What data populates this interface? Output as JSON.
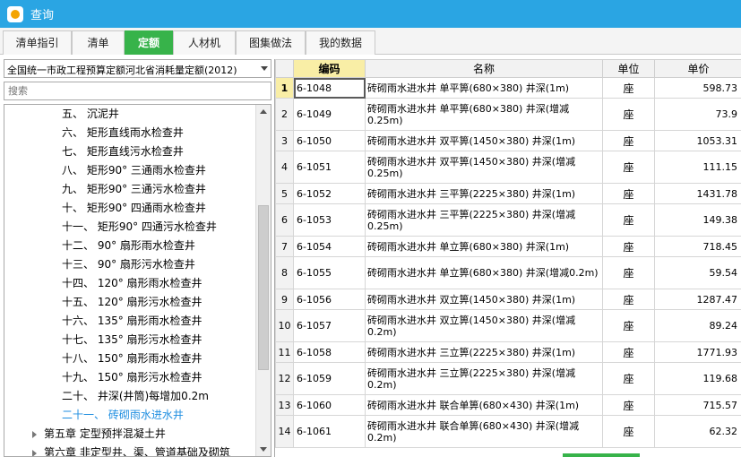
{
  "window": {
    "title": "查询"
  },
  "tabs": [
    {
      "label": "清单指引",
      "active": false
    },
    {
      "label": "清单",
      "active": false
    },
    {
      "label": "定额",
      "active": true
    },
    {
      "label": "人材机",
      "active": false
    },
    {
      "label": "图集做法",
      "active": false
    },
    {
      "label": "我的数据",
      "active": false
    }
  ],
  "left_panel": {
    "library_selected": "全国统一市政工程预算定额河北省消耗量定额(2012)",
    "search_placeholder": "搜索",
    "tree_items": [
      {
        "label": "五、 沉泥井",
        "level": 2
      },
      {
        "label": "六、 矩形直线雨水检查井",
        "level": 2
      },
      {
        "label": "七、 矩形直线污水检查井",
        "level": 2
      },
      {
        "label": "八、 矩形90° 三通雨水检查井",
        "level": 2
      },
      {
        "label": "九、 矩形90° 三通污水检查井",
        "level": 2
      },
      {
        "label": "十、 矩形90° 四通雨水检查井",
        "level": 2
      },
      {
        "label": "十一、 矩形90° 四通污水检查井",
        "level": 2
      },
      {
        "label": "十二、 90° 扇形雨水检查井",
        "level": 2
      },
      {
        "label": "十三、 90° 扇形污水检查井",
        "level": 2
      },
      {
        "label": "十四、 120° 扇形雨水检查井",
        "level": 2
      },
      {
        "label": "十五、 120° 扇形污水检查井",
        "level": 2
      },
      {
        "label": "十六、 135° 扇形雨水检查井",
        "level": 2
      },
      {
        "label": "十七、 135° 扇形污水检查井",
        "level": 2
      },
      {
        "label": "十八、 150° 扇形雨水检查井",
        "level": 2
      },
      {
        "label": "十九、 150° 扇形污水检查井",
        "level": 2
      },
      {
        "label": "二十、 井深(井筒)每增加0.2m",
        "level": 2
      },
      {
        "label": "二十一、 砖砌雨水进水井",
        "level": 2,
        "selected": true
      },
      {
        "label": "第五章 定型预拌混凝土井",
        "level": 1
      },
      {
        "label": "第六章 非定型井、渠、管道基础及砌筑",
        "level": 1
      }
    ]
  },
  "grid": {
    "headers": {
      "row_no": "",
      "code": "编码",
      "name": "名称",
      "unit": "单位",
      "price": "单价"
    },
    "rows": [
      {
        "no": "1",
        "code": "6-1048",
        "name": "砖砌雨水进水井 单平箅(680×380) 井深(1m)",
        "unit": "座",
        "price": "598.73"
      },
      {
        "no": "2",
        "code": "6-1049",
        "name": "砖砌雨水进水井 单平箅(680×380) 井深(增减0.25m)",
        "unit": "座",
        "price": "73.9"
      },
      {
        "no": "3",
        "code": "6-1050",
        "name": "砖砌雨水进水井 双平箅(1450×380) 井深(1m)",
        "unit": "座",
        "price": "1053.31"
      },
      {
        "no": "4",
        "code": "6-1051",
        "name": "砖砌雨水进水井 双平箅(1450×380) 井深(增减0.25m)",
        "unit": "座",
        "price": "111.15"
      },
      {
        "no": "5",
        "code": "6-1052",
        "name": "砖砌雨水进水井 三平箅(2225×380) 井深(1m)",
        "unit": "座",
        "price": "1431.78"
      },
      {
        "no": "6",
        "code": "6-1053",
        "name": "砖砌雨水进水井 三平箅(2225×380) 井深(增减0.25m)",
        "unit": "座",
        "price": "149.38"
      },
      {
        "no": "7",
        "code": "6-1054",
        "name": "砖砌雨水进水井 单立箅(680×380) 井深(1m)",
        "unit": "座",
        "price": "718.45"
      },
      {
        "no": "8",
        "code": "6-1055",
        "name": "砖砌雨水进水井 单立箅(680×380) 井深(增减0.2m)",
        "unit": "座",
        "price": "59.54"
      },
      {
        "no": "9",
        "code": "6-1056",
        "name": "砖砌雨水进水井 双立箅(1450×380) 井深(1m)",
        "unit": "座",
        "price": "1287.47"
      },
      {
        "no": "10",
        "code": "6-1057",
        "name": "砖砌雨水进水井 双立箅(1450×380) 井深(增减0.2m)",
        "unit": "座",
        "price": "89.24"
      },
      {
        "no": "11",
        "code": "6-1058",
        "name": "砖砌雨水进水井 三立箅(2225×380) 井深(1m)",
        "unit": "座",
        "price": "1771.93"
      },
      {
        "no": "12",
        "code": "6-1059",
        "name": "砖砌雨水进水井 三立箅(2225×380) 井深(增减0.2m)",
        "unit": "座",
        "price": "119.68"
      },
      {
        "no": "13",
        "code": "6-1060",
        "name": "砖砌雨水进水井 联合单箅(680×430) 井深(1m)",
        "unit": "座",
        "price": "715.57"
      },
      {
        "no": "14",
        "code": "6-1061",
        "name": "砖砌雨水进水井 联合单箅(680×430) 井深(增减0.2m)",
        "unit": "座",
        "price": "62.32"
      }
    ]
  }
}
